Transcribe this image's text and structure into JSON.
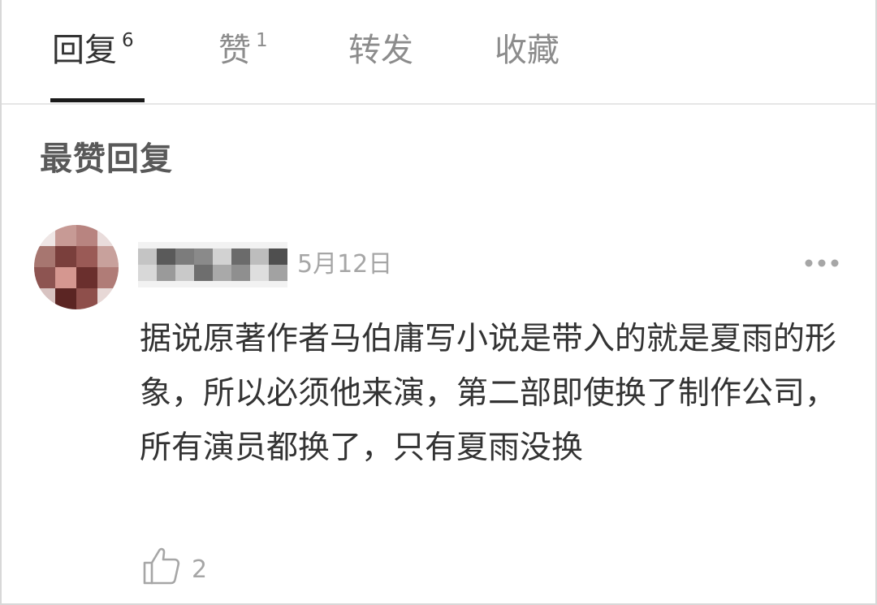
{
  "tabs": [
    {
      "label": "回复",
      "count": "6",
      "active": true
    },
    {
      "label": "赞",
      "count": "1",
      "active": false
    },
    {
      "label": "转发",
      "count": "",
      "active": false
    },
    {
      "label": "收藏",
      "count": "",
      "active": false
    }
  ],
  "section": {
    "title": "最赞回复"
  },
  "comment": {
    "date": "5月12日",
    "text": "据说原著作者马伯庸写小说是带入的就是夏雨的形象，所以必须他来演，第二部即使换了制作公司，所有演员都换了，只有夏雨没换",
    "like_count": "2"
  },
  "icons": {
    "more": "more-dots-icon",
    "like": "thumbs-up-icon"
  },
  "colors": {
    "active_tab": "#333333",
    "inactive_tab": "#8c8c8c",
    "muted": "#a6a6a6",
    "underline": "#1a1a1a"
  }
}
